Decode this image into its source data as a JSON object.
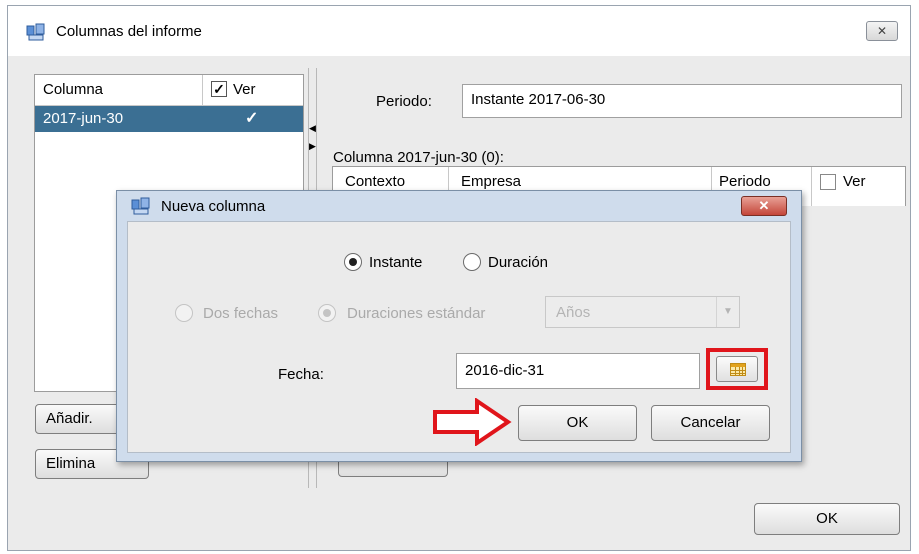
{
  "window": {
    "title": "Columnas del informe",
    "close_glyph": "✕",
    "icon": "report-columns-icon"
  },
  "column_list": {
    "header_column": "Columna",
    "header_ver": "Ver",
    "header_ver_checked": true,
    "rows": [
      {
        "name": "2017-jun-30",
        "ver": true
      }
    ]
  },
  "periodo": {
    "label": "Periodo:",
    "value": "Instante 2017-06-30"
  },
  "columna_detail": {
    "title": "Columna 2017-jun-30 (0):",
    "headers": [
      "Contexto",
      "Empresa",
      "Periodo",
      "Ver"
    ],
    "ver_checked": false
  },
  "left_buttons": {
    "add": "Añadir.",
    "remove": "Elimina"
  },
  "ok_button": "OK",
  "dialog": {
    "title": "Nueva columna",
    "close_glyph": "✕",
    "radio_instante": "Instante",
    "radio_duracion": "Duración",
    "instante_selected": true,
    "radio_dos_fechas": "Dos fechas",
    "radio_duraciones": "Duraciones estándar",
    "duracion_select": "Años",
    "fecha_label": "Fecha:",
    "fecha_value": "2016-dic-31",
    "calendar_icon": "calendar-icon",
    "ok": "OK",
    "cancel": "Cancelar"
  },
  "annotation_colors": {
    "highlight": "#e0151b"
  }
}
